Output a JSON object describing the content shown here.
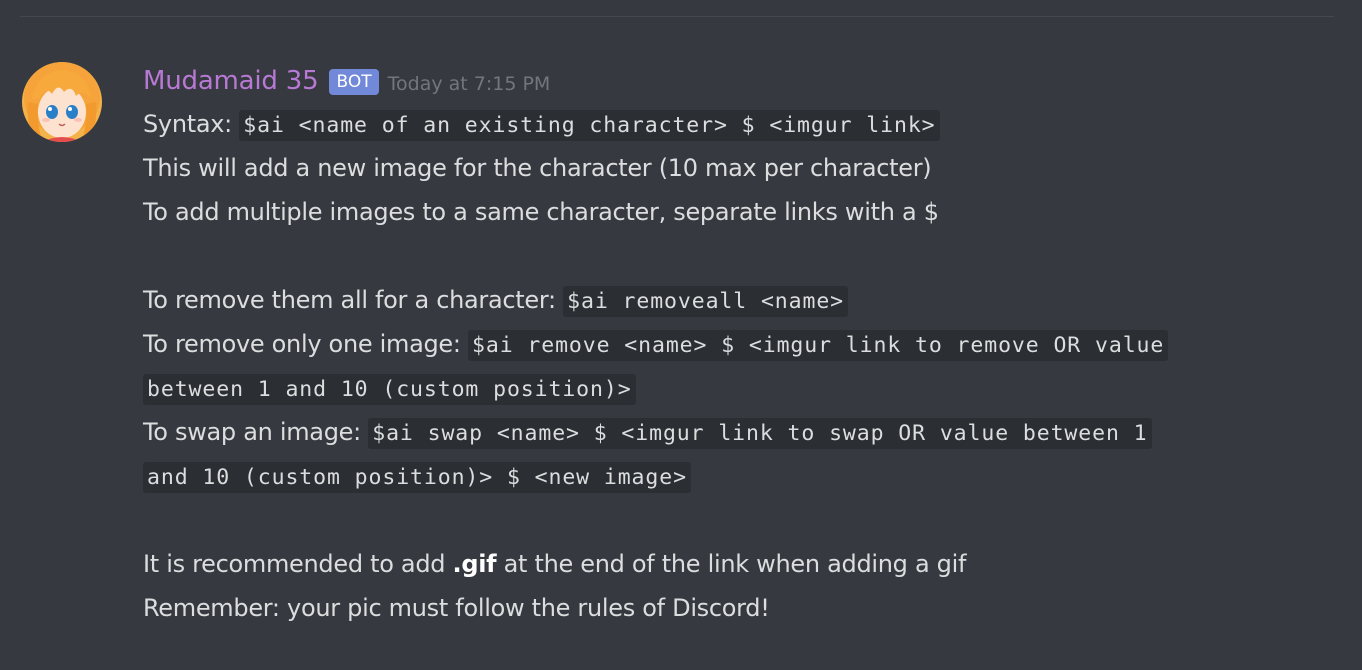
{
  "message": {
    "author": {
      "username": "Mudamaid 35",
      "bot_tag": "BOT",
      "timestamp": "Today at 7:15 PM",
      "name_color": "#b779d4",
      "avatar_icon": "anime-girl-avatar"
    },
    "lines": {
      "syntax_prefix": "Syntax: ",
      "syntax_code": "$ai <name of an existing character> $ <imgur link>",
      "add_desc": "This will add a new image for the character (10 max per character)",
      "multi_desc": "To add multiple images to a same character, separate links with a $",
      "removeall_prefix": "To remove them all for a character: ",
      "removeall_code": "$ai removeall <name>",
      "remove_prefix": "To remove only one image: ",
      "remove_code_1": "$ai remove <name> $ <imgur link to remove OR value",
      "remove_code_2": "between 1 and 10 (custom position)>",
      "swap_prefix": "To swap an image: ",
      "swap_code_1": "$ai swap <name> $ <imgur link to swap OR value between 1",
      "swap_code_2": "and 10 (custom position)> $ <new image>",
      "gif_prefix": "It is recommended to add ",
      "gif_bold": ".gif",
      "gif_suffix": " at the end of the link when adding a gif",
      "rules": "Remember: your pic must follow the rules of Discord!"
    }
  },
  "colors": {
    "background": "#36393f",
    "code_background": "#2b2e33",
    "bot_tag": "#7289da",
    "timestamp": "#72767d",
    "text": "#dcddde"
  }
}
